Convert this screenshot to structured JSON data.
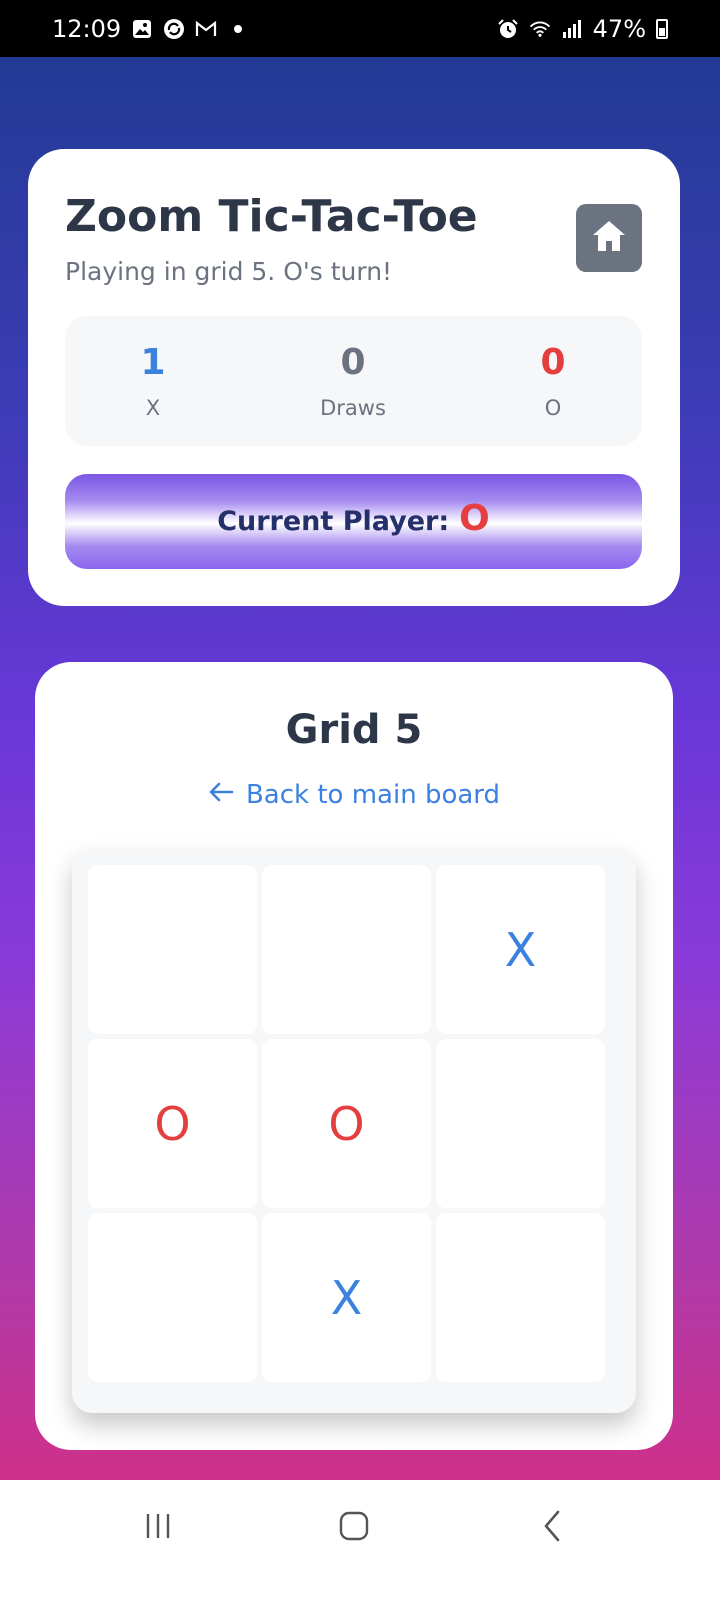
{
  "status_bar": {
    "time": "12:09",
    "battery": "47%",
    "notification_icons": [
      "image-icon",
      "sync-icon",
      "gmail-icon",
      "dot-icon"
    ],
    "system_icons": [
      "alarm-icon",
      "wifi-icon",
      "signal-icon",
      "battery-icon"
    ]
  },
  "header": {
    "title": "Zoom Tic-Tac-Toe",
    "subtitle": "Playing in grid 5. O's turn!",
    "home_icon": "home-icon"
  },
  "scores": {
    "x": {
      "value": "1",
      "label": "X",
      "color": "#3b82e0"
    },
    "draws": {
      "value": "0",
      "label": "Draws",
      "color": "#6b7280"
    },
    "o": {
      "value": "0",
      "label": "O",
      "color": "#e53e3e"
    }
  },
  "current_player": {
    "label": "Current Player:",
    "value": "O"
  },
  "grid": {
    "title": "Grid 5",
    "back_label": "Back to main board",
    "cells": [
      "",
      "",
      "X",
      "O",
      "O",
      "",
      "",
      "X",
      ""
    ]
  },
  "colors": {
    "x": "#3b82e0",
    "o": "#e53e3e",
    "title_text": "#2d3748",
    "home_button": "#6b7280"
  },
  "nav": {
    "recents_icon": "recents-icon",
    "home_icon": "home-outline-icon",
    "back_icon": "back-chevron-icon"
  }
}
